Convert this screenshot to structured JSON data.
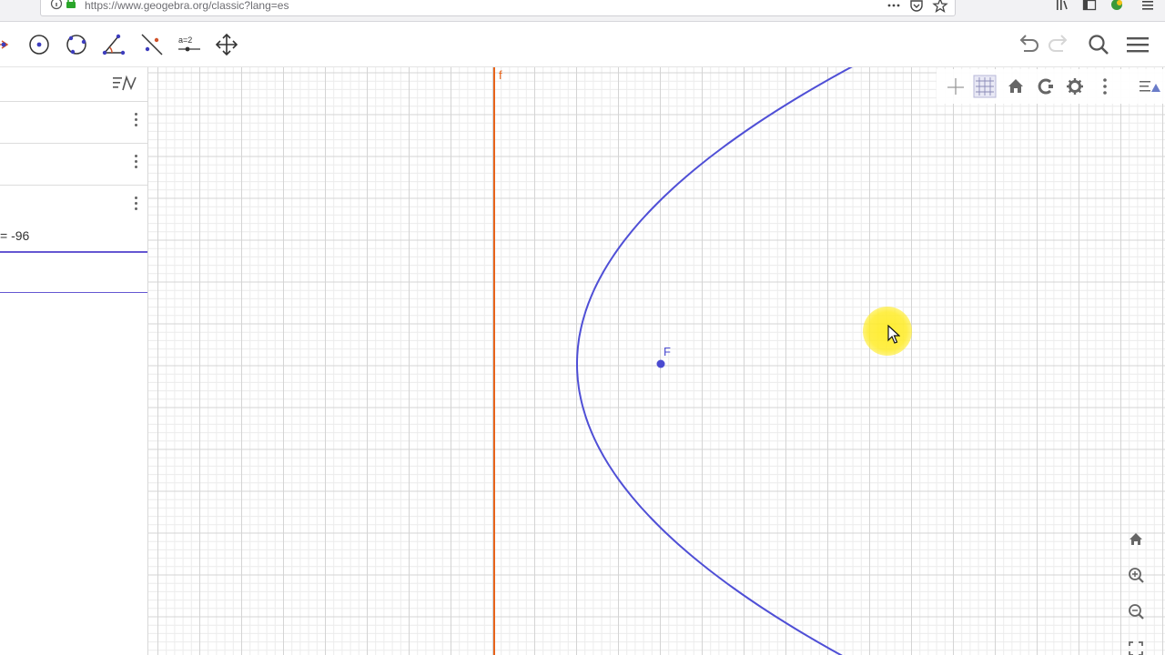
{
  "browser": {
    "url": "https://www.geogebra.org/classic?lang=es"
  },
  "algebra": {
    "visible_value": "= -96"
  },
  "graphics": {
    "labels": {
      "line": "f",
      "point": "F"
    },
    "colors": {
      "grid_minor": "#ececec",
      "grid_major": "#d4d4d4",
      "line": "#e8641b",
      "curve": "#4f4fd6",
      "point": "#4a4ad0"
    }
  },
  "icons": {
    "toolbar": [
      "point-tool-icon",
      "circle-center-icon",
      "circle-three-points-icon",
      "angle-tool-icon",
      "reflect-tool-icon",
      "slider-tool-icon",
      "move-graphics-icon"
    ],
    "toolbar_right": [
      "undo-icon",
      "redo-icon",
      "search-icon",
      "menu-icon"
    ],
    "style_bar": [
      "axes-toggle-icon",
      "grid-toggle-icon",
      "home-icon",
      "capture-icon",
      "gear-icon",
      "more-icon",
      "style-bar-toggle-icon"
    ],
    "zoom": [
      "home-icon",
      "zoom-in-icon",
      "zoom-out-icon",
      "fullscreen-icon"
    ]
  },
  "slider_icon_label": "a=2"
}
